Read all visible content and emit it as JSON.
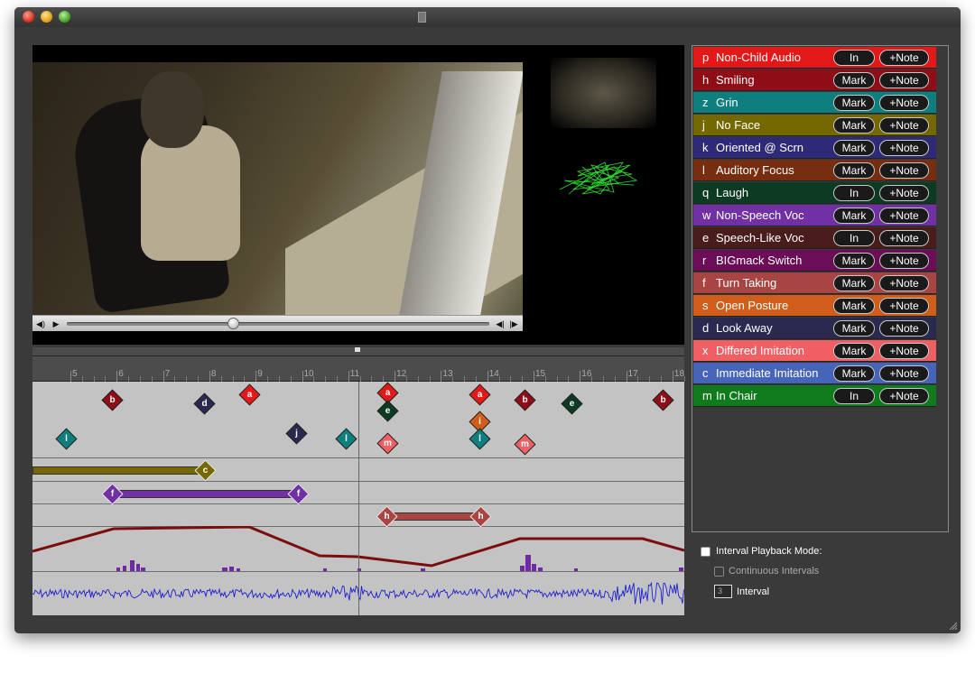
{
  "categories": [
    {
      "key": "p",
      "name": "Non-Child Audio",
      "btn": "In",
      "note": "+Note",
      "color": "#e31919"
    },
    {
      "key": "h",
      "name": "Smiling",
      "btn": "Mark",
      "note": "+Note",
      "color": "#8f0d16"
    },
    {
      "key": "z",
      "name": "Grin",
      "btn": "Mark",
      "note": "+Note",
      "color": "#0e7e7e"
    },
    {
      "key": "j",
      "name": "No Face",
      "btn": "Mark",
      "note": "+Note",
      "color": "#766800"
    },
    {
      "key": "k",
      "name": "Oriented @ Scrn",
      "btn": "Mark",
      "note": "+Note",
      "color": "#2f2a78"
    },
    {
      "key": "l",
      "name": "Auditory Focus",
      "btn": "Mark",
      "note": "+Note",
      "color": "#772e10"
    },
    {
      "key": "q",
      "name": "Laugh",
      "btn": "In",
      "note": "+Note",
      "color": "#0d3a23"
    },
    {
      "key": "w",
      "name": "Non-Speech Voc",
      "btn": "Mark",
      "note": "+Note",
      "color": "#7131a4"
    },
    {
      "key": "e",
      "name": "Speech-Like Voc",
      "btn": "In",
      "note": "+Note",
      "color": "#4a1d1d"
    },
    {
      "key": "r",
      "name": "BIGmack Switch",
      "btn": "Mark",
      "note": "+Note",
      "color": "#6c0d58"
    },
    {
      "key": "f",
      "name": "Turn Taking",
      "btn": "Mark",
      "note": "+Note",
      "color": "#a84441"
    },
    {
      "key": "s",
      "name": "Open Posture",
      "btn": "Mark",
      "note": "+Note",
      "color": "#d15d1a"
    },
    {
      "key": "d",
      "name": "Look Away",
      "btn": "Mark",
      "note": "+Note",
      "color": "#2a2950"
    },
    {
      "key": "x",
      "name": "Differed Imitation",
      "btn": "Mark",
      "note": "+Note",
      "color": "#ef5f64"
    },
    {
      "key": "c",
      "name": "Immediate Imitation",
      "btn": "Mark",
      "note": "+Note",
      "color": "#4765b8"
    },
    {
      "key": "m",
      "name": "In Chair",
      "btn": "In",
      "note": "+Note",
      "color": "#107b1c"
    }
  ],
  "ruler": {
    "ticks": [
      "5",
      "6",
      "7",
      "8",
      "9",
      "10",
      "11",
      "12",
      "13",
      "14",
      "15",
      "16",
      "17",
      "18"
    ]
  },
  "markers": [
    {
      "label": "b",
      "color": "#8f0d16"
    },
    {
      "label": "d",
      "color": "#2a2950"
    },
    {
      "label": "a",
      "color": "#e31919"
    },
    {
      "label": "l",
      "color": "#0e7e7e"
    },
    {
      "label": "j",
      "color": "#2a2950"
    },
    {
      "label": "l",
      "color": "#0e7e7e"
    },
    {
      "label": "a",
      "color": "#e31919"
    },
    {
      "label": "e",
      "color": "#0d3a23"
    },
    {
      "label": "m",
      "color": "#ef5f64"
    },
    {
      "label": "a",
      "color": "#e31919"
    },
    {
      "label": "i",
      "color": "#d15d1a"
    },
    {
      "label": "l",
      "color": "#0e7e7e"
    },
    {
      "label": "b",
      "color": "#8f0d16"
    },
    {
      "label": "m",
      "color": "#ef5f64"
    },
    {
      "label": "e",
      "color": "#0d3a23"
    },
    {
      "label": "b",
      "color": "#8f0d16"
    }
  ],
  "intervals": [
    {
      "label_end": "c",
      "color": "#766800"
    },
    {
      "label_start": "f",
      "label_end": "f",
      "color": "#7131a4"
    },
    {
      "label_start": "h",
      "label_end": "h",
      "color": "#a84441"
    }
  ],
  "options": {
    "interval_playback": "Interval Playback Mode:",
    "continuous": "Continuous Intervals",
    "interval_value": "3",
    "interval_label": "Interval"
  }
}
